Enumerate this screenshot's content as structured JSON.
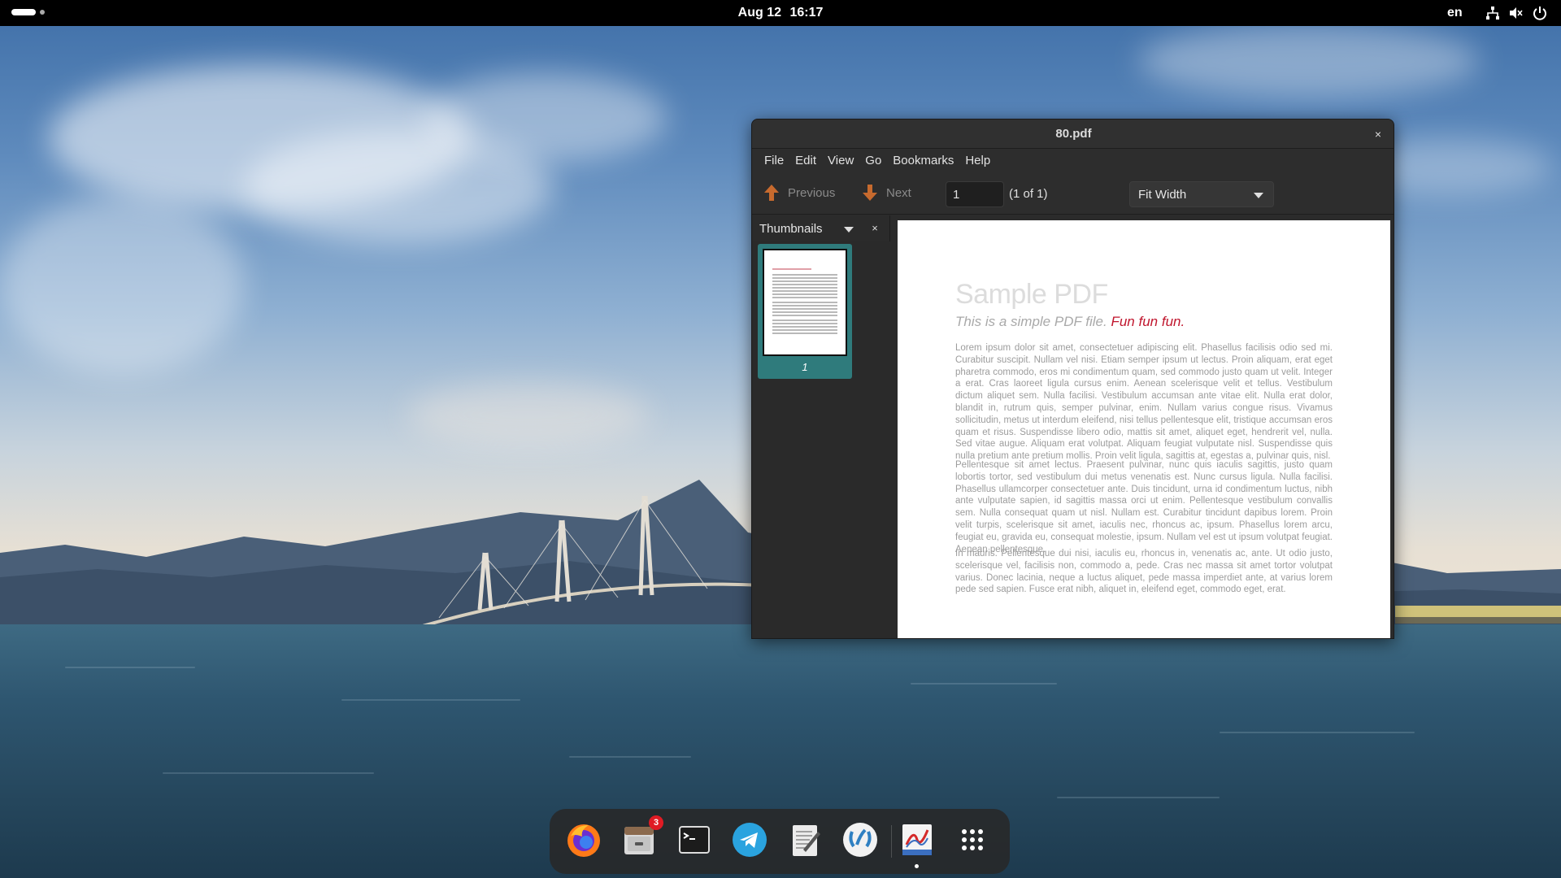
{
  "topbar": {
    "date": "Aug 12",
    "time": "16:17",
    "lang": "en"
  },
  "window": {
    "title": "80.pdf",
    "close_label": "×",
    "menu": [
      "File",
      "Edit",
      "View",
      "Go",
      "Bookmarks",
      "Help"
    ],
    "toolbar": {
      "previous_label": "Previous",
      "next_label": "Next",
      "page_value": "1",
      "page_count": "(1 of 1)",
      "zoom_value": "Fit Width"
    },
    "sidebar": {
      "title": "Thumbnails",
      "close_label": "×",
      "thumbnail_label": "1"
    },
    "document": {
      "title": "Sample PDF",
      "subtitle": "This is a simple PDF file.",
      "subtitle_highlight": "Fun fun fun.",
      "paragraph_1": "Lorem ipsum dolor sit amet, consectetuer adipiscing elit. Phasellus facilisis odio sed mi. Curabitur suscipit. Nullam vel nisi. Etiam semper ipsum ut lectus. Proin aliquam, erat eget pharetra commodo, eros mi condimentum quam, sed commodo justo quam ut velit. Integer a erat. Cras laoreet ligula cursus enim. Aenean scelerisque velit et tellus. Vestibulum dictum aliquet sem. Nulla facilisi. Vestibulum accumsan ante vitae elit. Nulla erat dolor, blandit in, rutrum quis, semper pulvinar, enim. Nullam varius congue risus. Vivamus sollicitudin, metus ut interdum eleifend, nisi tellus pellentesque elit, tristique accumsan eros quam et risus. Suspendisse libero odio, mattis sit amet, aliquet eget, hendrerit vel, nulla. Sed vitae augue. Aliquam erat volutpat. Aliquam feugiat vulputate nisl. Suspendisse quis nulla pretium ante pretium mollis. Proin velit ligula, sagittis at, egestas a, pulvinar quis, nisl.",
      "paragraph_2": "Pellentesque sit amet lectus. Praesent pulvinar, nunc quis iaculis sagittis, justo quam lobortis tortor, sed vestibulum dui metus venenatis est. Nunc cursus ligula. Nulla facilisi. Phasellus ullamcorper consectetuer ante. Duis tincidunt, urna id condimentum luctus, nibh ante vulputate sapien, id sagittis massa orci ut enim. Pellentesque vestibulum convallis sem. Nulla consequat quam ut nisl. Nullam est. Curabitur tincidunt dapibus lorem. Proin velit turpis, scelerisque sit amet, iaculis nec, rhoncus ac, ipsum. Phasellus lorem arcu, feugiat eu, gravida eu, consequat molestie, ipsum. Nullam vel est ut ipsum volutpat feugiat. Aenean pellentesque.",
      "paragraph_3": "In mauris. Pellentesque dui nisi, iaculis eu, rhoncus in, venenatis ac, ante. Ut odio justo, scelerisque vel, facilisis non, commodo a, pede. Cras nec massa sit amet tortor volutpat varius. Donec lacinia, neque a luctus aliquet, pede massa imperdiet ante, at varius lorem pede sed sapien. Fusce erat nibh, aliquet in, eleifend eget, commodo eget, erat."
    }
  },
  "dock": {
    "items": [
      {
        "name": "firefox",
        "icon": "firefox-icon"
      },
      {
        "name": "files",
        "icon": "file-cabinet-icon",
        "badge": "3"
      },
      {
        "name": "terminal",
        "icon": "terminal-icon"
      },
      {
        "name": "telegram",
        "icon": "telegram-icon"
      },
      {
        "name": "text-editor",
        "icon": "text-editor-icon"
      },
      {
        "name": "vscodium",
        "icon": "vscodium-icon"
      },
      {
        "name": "document-viewer",
        "icon": "pdf-viewer-icon"
      },
      {
        "name": "app-grid",
        "icon": "app-grid-icon"
      }
    ]
  }
}
